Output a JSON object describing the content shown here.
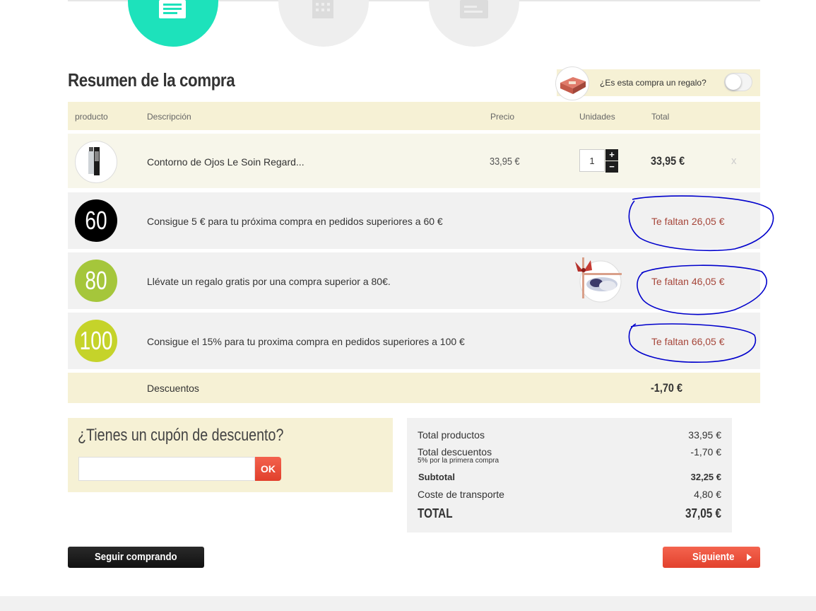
{
  "cart": {
    "title": "Resumen de la compra",
    "gift_question": "¿Es esta compra un regalo?",
    "headers": {
      "product": "producto",
      "description": "Descripción",
      "price": "Precio",
      "units": "Unidades",
      "total": "Total"
    },
    "item": {
      "description": "Contorno de Ojos Le Soin Regard...",
      "price": "33,95 €",
      "quantity": "1",
      "plus": "+",
      "minus": "−",
      "total": "33,95 €",
      "remove": "x"
    },
    "promos": [
      {
        "badge": "60",
        "text": "Consigue 5 € para tu próxima compra en pedidos superiores a 60 €",
        "missing": "Te faltan 26,05 €",
        "color": "#000000"
      },
      {
        "badge": "80",
        "text": "Llévate un regalo gratis por una compra superior a 80€.",
        "missing": "Te faltan 46,05 €",
        "color": "#a5c63b"
      },
      {
        "badge": "100",
        "text": "Consigue el 15% para tu proxima compra en pedidos superiores a 100 €",
        "missing": "Te faltan 66,05 €",
        "color": "#c5d32a"
      }
    ],
    "discounts": {
      "label": "Descuentos",
      "value": "-1,70 €"
    }
  },
  "coupon": {
    "title": "¿Tienes un cupón de descuento?",
    "value": "",
    "ok": "OK"
  },
  "totals": {
    "products_label": "Total productos",
    "products_value": "33,95 €",
    "discounts_label": "Total descuentos",
    "discounts_value": "-1,70 €",
    "discounts_note": "5% por la primera compra",
    "subtotal_label": "Subtotal",
    "subtotal_value": "32,25 €",
    "shipping_label": "Coste de transporte",
    "shipping_value": "4,80 €",
    "total_label": "TOTAL",
    "total_value": "37,05 €"
  },
  "actions": {
    "continue_shopping": "Seguir comprando",
    "next": "Siguiente"
  },
  "steps": [
    {
      "icon": "document-list-icon",
      "active": true
    },
    {
      "icon": "building-icon",
      "active": false
    },
    {
      "icon": "card-icon",
      "active": false
    }
  ],
  "colors": {
    "accent": "#1de2bb",
    "button_red": "#e9503b",
    "highlight_bg": "#f6f1d5",
    "missing_text": "#a6463a",
    "annotation": "#0000cc"
  }
}
